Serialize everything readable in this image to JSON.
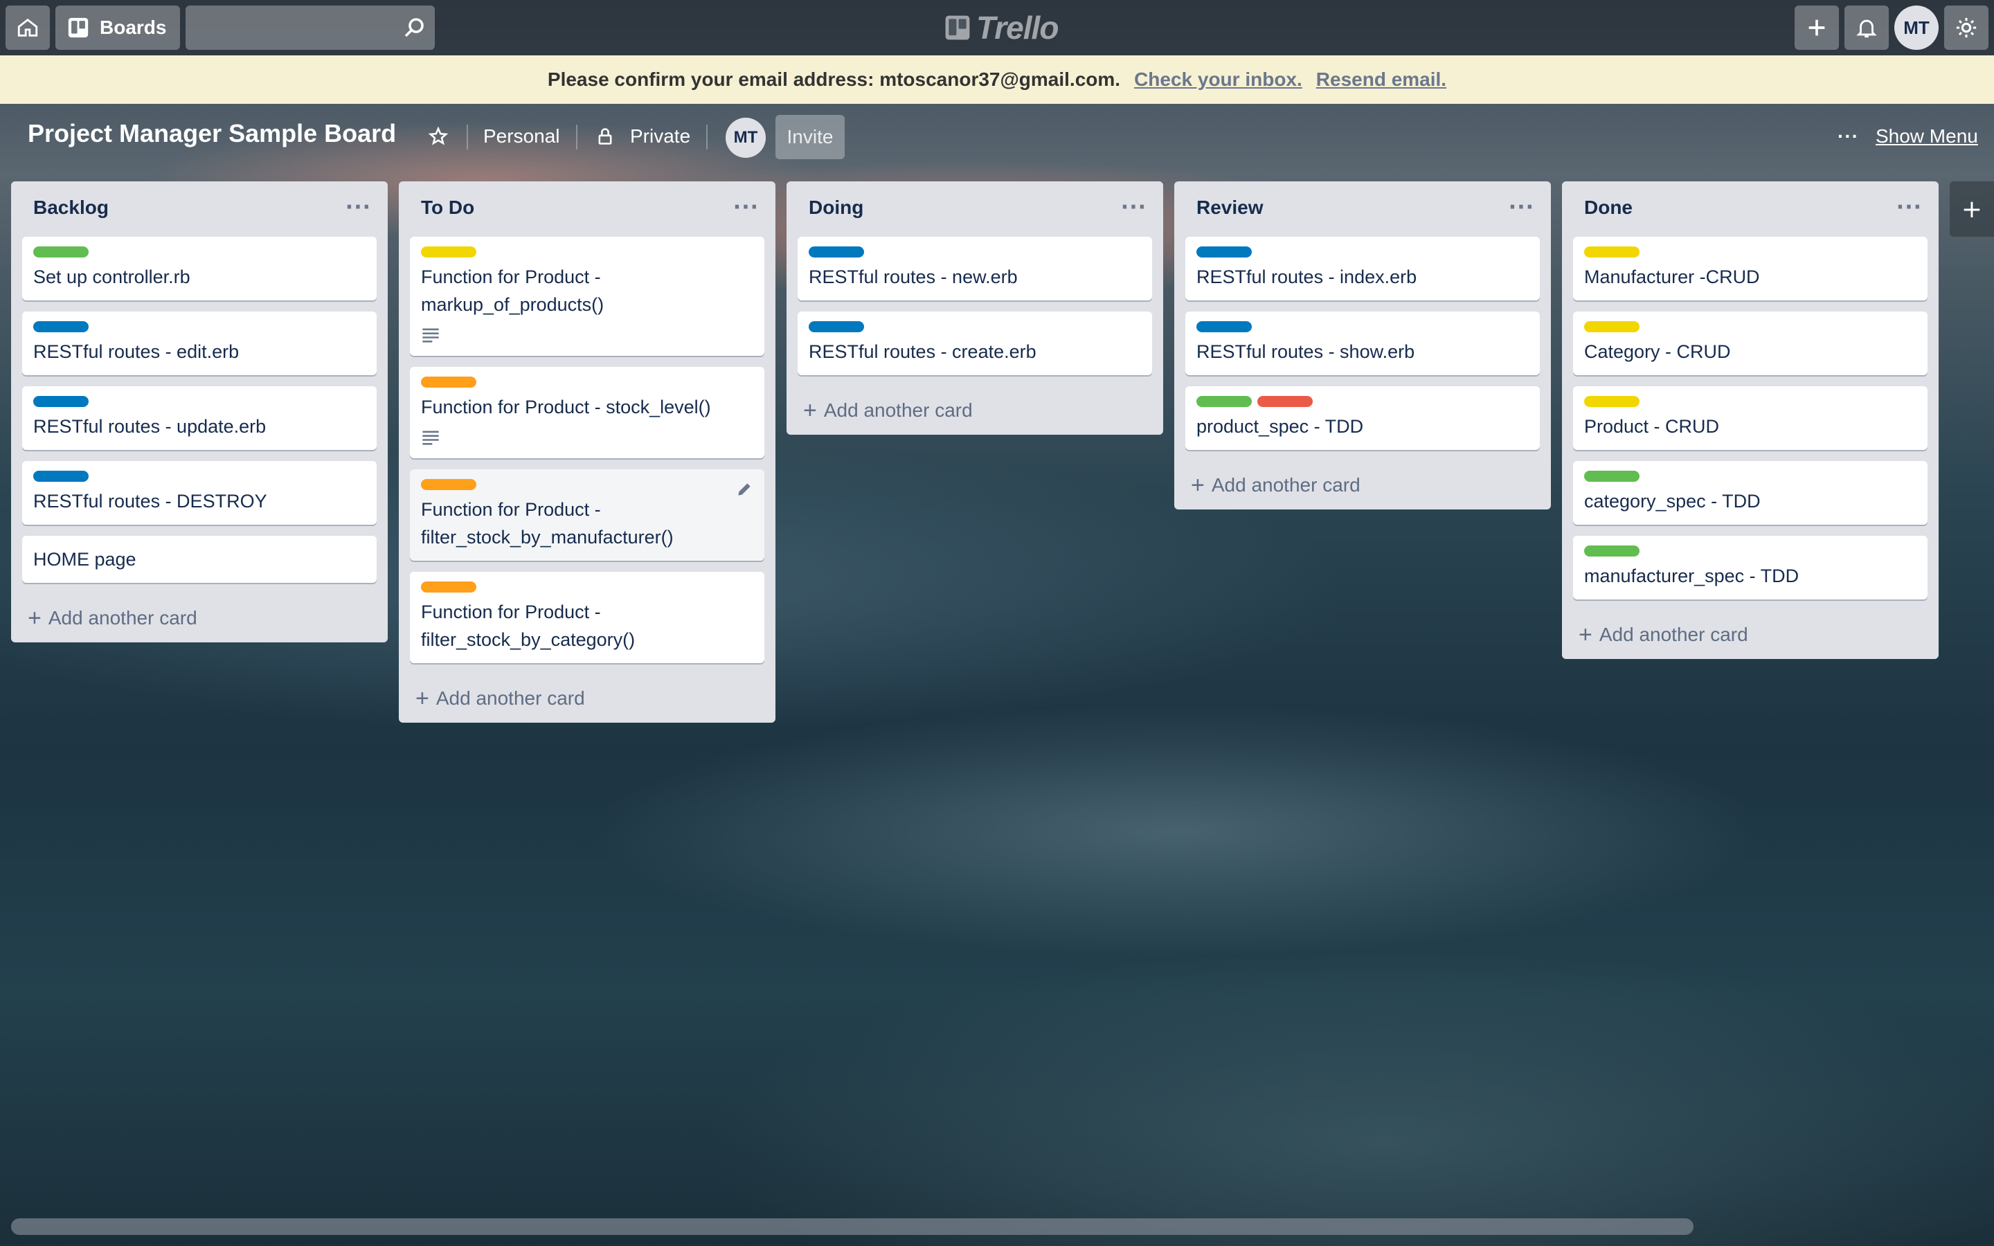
{
  "header": {
    "boards_label": "Boards",
    "search_placeholder": "",
    "logo_text": "Trello",
    "user_initials": "MT"
  },
  "banner": {
    "message": "Please confirm your email address: mtoscanor37@gmail.com.",
    "check_inbox": "Check your inbox.",
    "resend": "Resend email."
  },
  "board": {
    "title": "Project Manager Sample Board",
    "team": "Personal",
    "visibility": "Private",
    "member_initials": "MT",
    "invite_label": "Invite",
    "show_menu_label": "Show Menu",
    "menu_dots": "···"
  },
  "label_colors": {
    "green": "#61bd4f",
    "blue": "#0079bf",
    "yellow": "#f2d600",
    "orange": "#ff9f1a",
    "red": "#eb5a46"
  },
  "lists": [
    {
      "title": "Backlog",
      "add_label": "Add another card",
      "cards": [
        {
          "labels": [
            "green"
          ],
          "title": "Set up controller.rb"
        },
        {
          "labels": [
            "blue"
          ],
          "title": "RESTful routes - edit.erb"
        },
        {
          "labels": [
            "blue"
          ],
          "title": "RESTful routes - update.erb"
        },
        {
          "labels": [
            "blue"
          ],
          "title": "RESTful routes - DESTROY"
        },
        {
          "labels": [],
          "title": "HOME page"
        }
      ]
    },
    {
      "title": "To Do",
      "add_label": "Add another card",
      "cards": [
        {
          "labels": [
            "yellow"
          ],
          "title": "Function for Product - markup_of_products()",
          "has_description": true
        },
        {
          "labels": [
            "orange"
          ],
          "title": "Function for Product - stock_level()",
          "has_description": true
        },
        {
          "labels": [
            "orange"
          ],
          "title": "Function for Product - filter_stock_by_manufacturer()",
          "hovered": true
        },
        {
          "labels": [
            "orange"
          ],
          "title": "Function for Product - filter_stock_by_category()"
        }
      ]
    },
    {
      "title": "Doing",
      "add_label": "Add another card",
      "cards": [
        {
          "labels": [
            "blue"
          ],
          "title": "RESTful routes - new.erb"
        },
        {
          "labels": [
            "blue"
          ],
          "title": "RESTful routes - create.erb"
        }
      ]
    },
    {
      "title": "Review",
      "add_label": "Add another card",
      "cards": [
        {
          "labels": [
            "blue"
          ],
          "title": "RESTful routes - index.erb"
        },
        {
          "labels": [
            "blue"
          ],
          "title": "RESTful routes - show.erb"
        },
        {
          "labels": [
            "green",
            "red"
          ],
          "title": "product_spec - TDD"
        }
      ]
    },
    {
      "title": "Done",
      "add_label": "Add another card",
      "cards": [
        {
          "labels": [
            "yellow"
          ],
          "title": "Manufacturer -CRUD"
        },
        {
          "labels": [
            "yellow"
          ],
          "title": "Category - CRUD"
        },
        {
          "labels": [
            "yellow"
          ],
          "title": "Product - CRUD"
        },
        {
          "labels": [
            "green"
          ],
          "title": "category_spec - TDD"
        },
        {
          "labels": [
            "green"
          ],
          "title": "manufacturer_spec - TDD"
        }
      ]
    }
  ]
}
